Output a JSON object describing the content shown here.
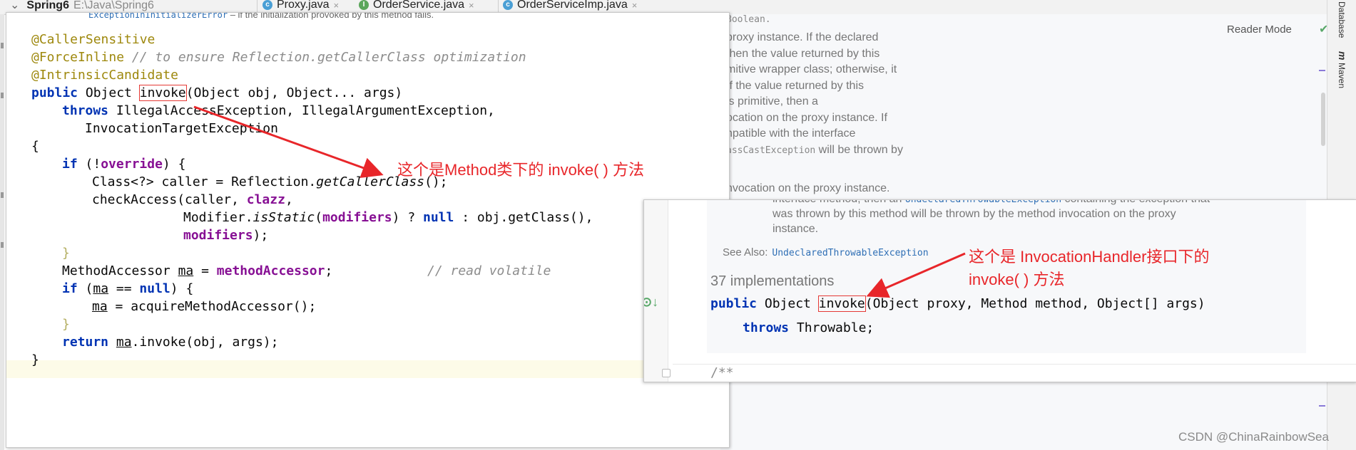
{
  "project": {
    "name": "Spring6",
    "path": "E:\\Java\\Spring6"
  },
  "tabs": [
    {
      "label": "Proxy.java",
      "icon": "class-icon"
    },
    {
      "label": "OrderService.java",
      "icon": "interface-icon"
    },
    {
      "label": "OrderServiceImp.java",
      "icon": "class-icon"
    }
  ],
  "reader_mode": "Reader Mode",
  "side_tools": {
    "database": "Database",
    "maven": "Maven"
  },
  "bg_doc": {
    "line0": "Boolean.",
    "line1": "proxy instance. If the declared",
    "line2": "then the value returned by this",
    "line3": "mitive wrapper class; otherwise, it",
    "line4": "If the value returned by this",
    "line5": "is primitive, then a",
    "line6": "ocation on the proxy instance. If",
    "line7": "npatible with the interface",
    "line8_code": "assCastException",
    "line8_tail": " will be thrown by",
    "line9": "nvocation on the proxy instance."
  },
  "method_panel": {
    "top_cut_code": "ExceptionInInitializerError",
    "top_cut_text": " – if the initialization provoked by this method fails.",
    "ann_caller_sensitive": "@CallerSensitive",
    "ann_force_inline": "@ForceInline",
    "comment_force_inline": "// to ensure Reflection.getCallerClass optimization",
    "ann_intrinsic": "@IntrinsicCandidate",
    "kw_public": "public",
    "ret_object": "Object",
    "method_name": "invoke",
    "params": "(Object obj, Object... args)",
    "kw_throws": "throws",
    "throws1": "IllegalAccessException, IllegalArgumentException,",
    "throws2": "InvocationTargetException",
    "open_brace": "{",
    "kw_if": "if",
    "if_override_pre": "(!",
    "if_override_field": "override",
    "if_override_post": ") {",
    "class_decl_pre": "Class<?> caller = Reflection.",
    "get_caller_class": "getCallerClass",
    "class_decl_post": "();",
    "check_access_pre": "checkAccess(caller, ",
    "clazz": "clazz",
    "comma": ",",
    "modifier_pre": "Modifier.",
    "is_static": "isStatic",
    "paren_open": "(",
    "modifiers": "modifiers",
    "ternary": ") ? ",
    "kw_null": "null",
    "ternary_tail": " : obj.getClass(),",
    "modifiers_end": ");",
    "close_brace": "}",
    "ma_decl_type": "MethodAccessor ",
    "ma": "ma",
    "ma_assign": " = ",
    "method_accessor": "methodAccessor",
    "semicolon": ";",
    "read_volatile": "// read volatile",
    "if_ma_pre": "(",
    "if_ma_mid": " == ",
    "if_ma_post": ") {",
    "acquire": " = acquireMethodAccessor();",
    "kw_return": "return",
    "return_tail": ".invoke(obj, args);"
  },
  "handler_panel": {
    "doc1_pre": "interface method, then an ",
    "doc1_code": "UndeclaredThrowableException",
    "doc1_post": " containing the exception that",
    "doc2": "was thrown by this method will be thrown by the method invocation on the proxy",
    "doc3": "instance.",
    "see_also_label": "See Also:",
    "see_also_link": "UndeclaredThrowableException",
    "implementations": "37 implementations",
    "kw_public": "public",
    "ret_object": "Object",
    "method_name": "invoke",
    "params": "(Object proxy, Method method, Object[] args)",
    "kw_throws": "throws",
    "throwable": "Throwable;",
    "javadoc_start": "/**"
  },
  "callouts": {
    "method_invoke": "这个是Method类下的 invoke( ) 方法",
    "handler_invoke_line1": "这个是 InvocationHandler接口下的",
    "handler_invoke_line2": "invoke( ) 方法"
  },
  "colors": {
    "annotation_red": "#e8262a",
    "keyword": "#0033b3",
    "field": "#871094"
  },
  "watermark": "CSDN @ChinaRainbowSea"
}
